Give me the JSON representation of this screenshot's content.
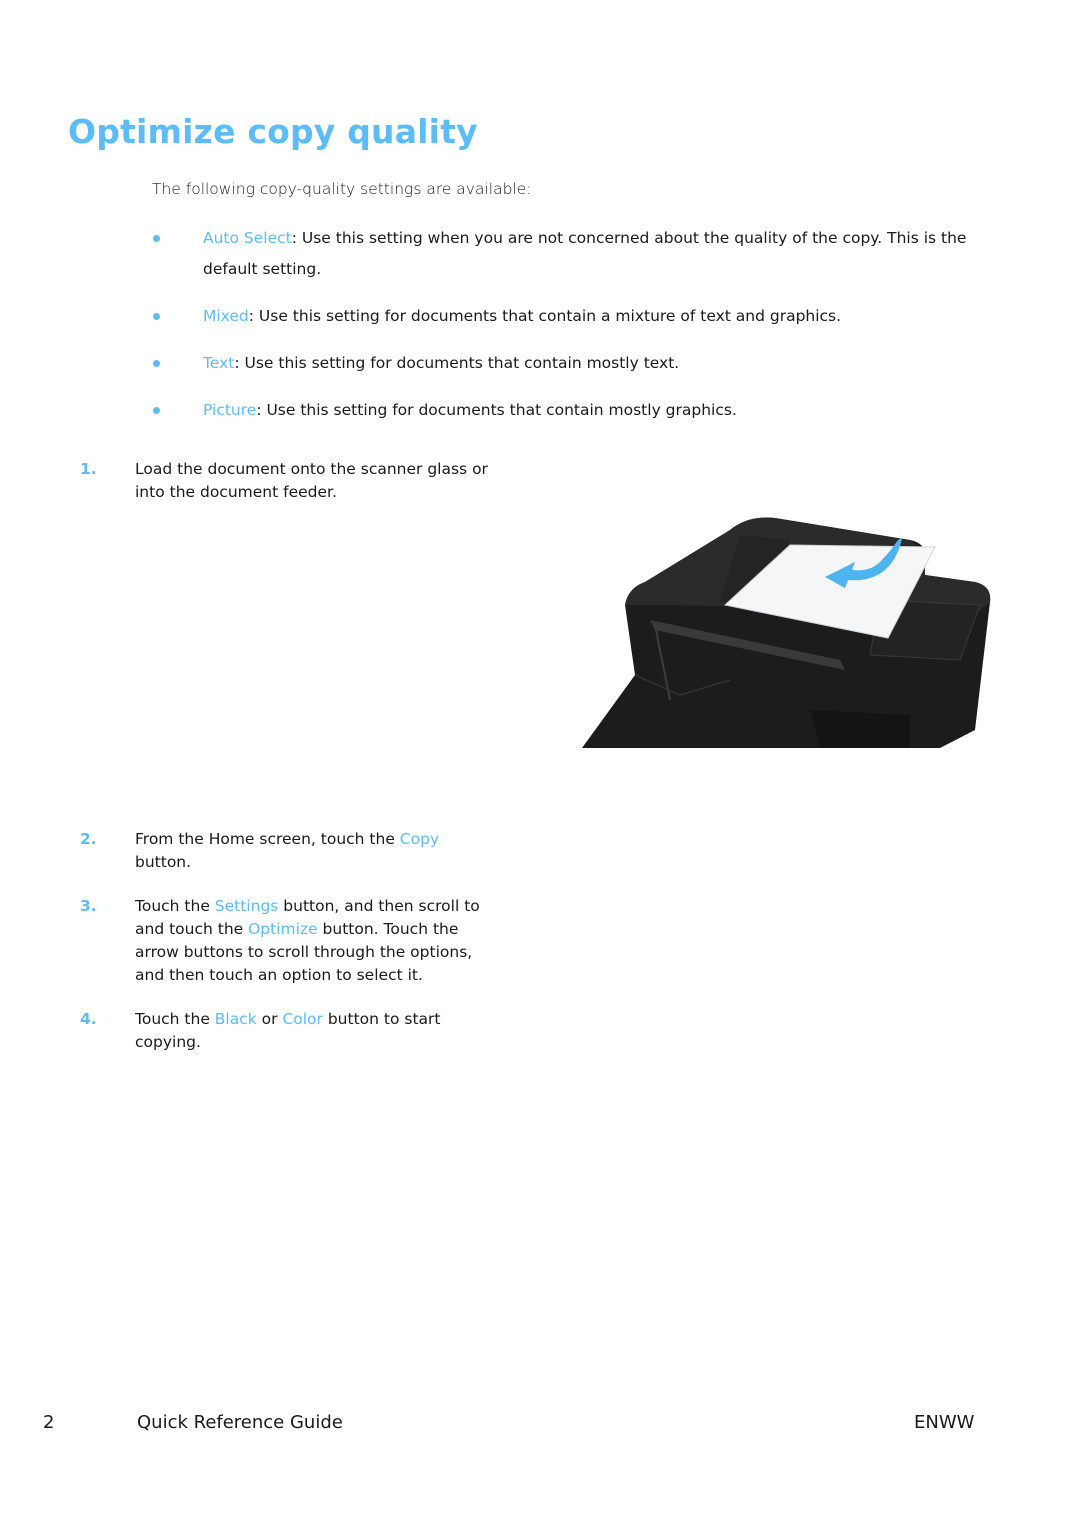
{
  "page": {
    "title": "Optimize copy quality",
    "intro": "The following copy-quality settings are available:",
    "settings": [
      {
        "name": "Auto Select",
        "description": ": Use this setting when you are not concerned about the quality of the copy. This is the default setting."
      },
      {
        "name": "Mixed",
        "description": ": Use this setting for documents that contain a mixture of text and graphics."
      },
      {
        "name": "Text",
        "description": ": Use this setting for documents that contain mostly text."
      },
      {
        "name": "Picture",
        "description": ": Use this setting for documents that contain mostly graphics."
      }
    ],
    "steps": [
      {
        "number": "1.",
        "parts": [
          {
            "text": "Load the document onto the scanner glass or into the document feeder.",
            "accent": false
          }
        ]
      },
      {
        "number": "2.",
        "parts": [
          {
            "text": "From the Home screen, touch the ",
            "accent": false
          },
          {
            "text": "Copy",
            "accent": true
          },
          {
            "text": " button.",
            "accent": false
          }
        ]
      },
      {
        "number": "3.",
        "parts": [
          {
            "text": "Touch the ",
            "accent": false
          },
          {
            "text": "Settings",
            "accent": true
          },
          {
            "text": " button, and then scroll to and touch the ",
            "accent": false
          },
          {
            "text": "Optimize",
            "accent": true
          },
          {
            "text": " button. Touch the arrow buttons to scroll through the options, and then touch an option to select it.",
            "accent": false
          }
        ]
      },
      {
        "number": "4.",
        "parts": [
          {
            "text": "Touch the ",
            "accent": false
          },
          {
            "text": "Black",
            "accent": true
          },
          {
            "text": " or ",
            "accent": false
          },
          {
            "text": "Color",
            "accent": true
          },
          {
            "text": " button to start copying.",
            "accent": false
          }
        ]
      }
    ],
    "illustration": {
      "icon": "printer-document-feeder-illustration",
      "arrow_icon": "load-arrow-icon"
    }
  },
  "footer": {
    "page_number": "2",
    "guide_title": "Quick Reference Guide",
    "locale_code": "ENWW"
  },
  "colors": {
    "accent": "#5cbcf7",
    "text": "#1a1a1a"
  }
}
